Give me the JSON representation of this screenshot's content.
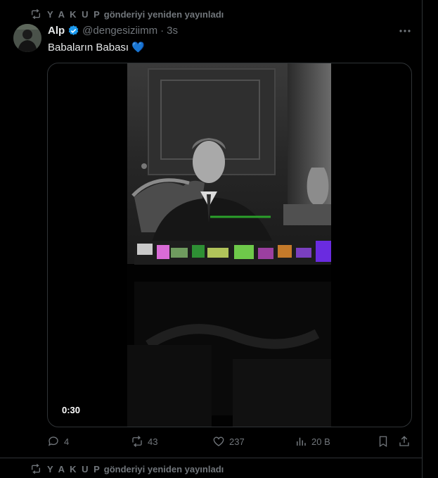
{
  "top_repost": {
    "name": "Y A K U P",
    "suffix": "gönderiyi yeniden yayınladı"
  },
  "tweet": {
    "author": "Alp",
    "handle": "@dengesiziimm",
    "dot": "·",
    "time": "3s",
    "text": "Babaların Babası",
    "emoji": "💙",
    "video": {
      "duration": "0:30"
    },
    "actions": {
      "replies": "4",
      "reposts": "43",
      "likes": "237",
      "views": "20 B"
    }
  },
  "bottom_repost": {
    "name": "Y A K U P",
    "suffix": "gönderiyi yeniden yayınladı"
  },
  "colors": {
    "accent": "#1d9bf0",
    "muted": "#71767b",
    "text": "#e7e9ea",
    "border": "#2f3336"
  },
  "icons": [
    "repost-icon",
    "verified-badge-icon",
    "more-icon",
    "reply-icon",
    "retweet-icon",
    "like-icon",
    "views-icon",
    "bookmark-icon",
    "share-icon"
  ]
}
